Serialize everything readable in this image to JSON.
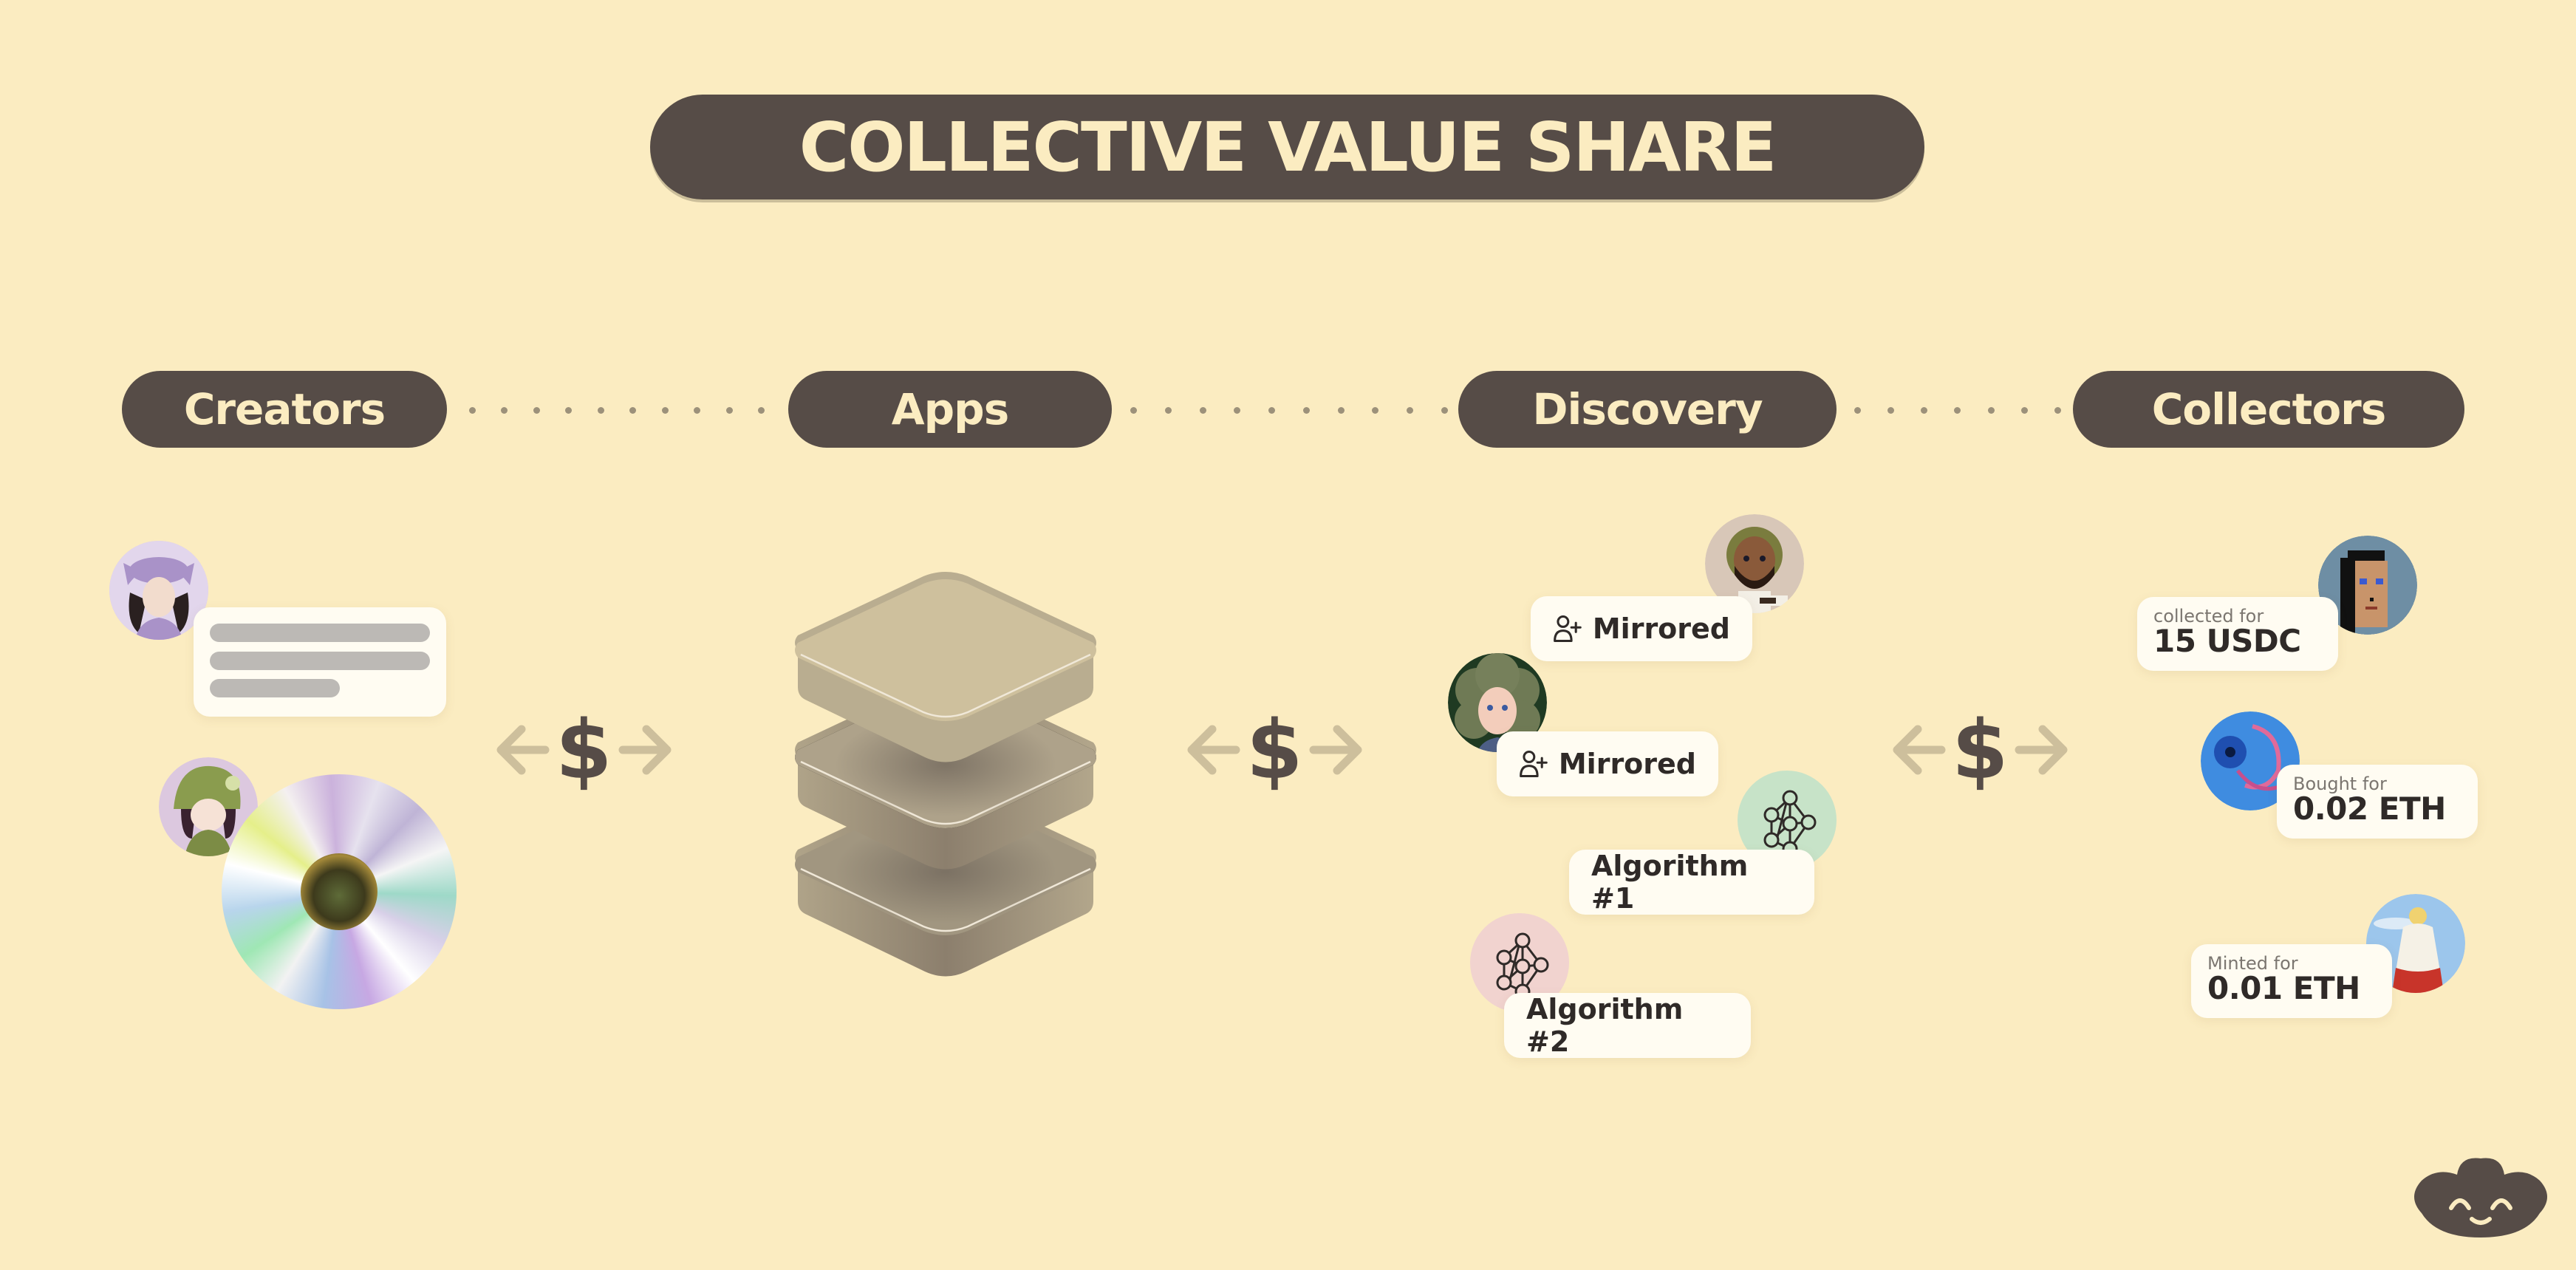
{
  "title": "COLLECTIVE VALUE SHARE",
  "stages": [
    {
      "label": "Creators"
    },
    {
      "label": "Apps"
    },
    {
      "label": "Discovery"
    },
    {
      "label": "Collectors"
    }
  ],
  "flow_symbol": "$",
  "discovery": {
    "mirrors": [
      {
        "label": "Mirrored"
      },
      {
        "label": "Mirrored"
      }
    ],
    "algorithms": [
      {
        "label": "Algorithm #1"
      },
      {
        "label": "Algorithm #2"
      }
    ]
  },
  "collectors": [
    {
      "caption": "collected for",
      "amount": "15 USDC"
    },
    {
      "caption": "Bought for",
      "amount": "0.02 ETH"
    },
    {
      "caption": "Minted for",
      "amount": "0.01 ETH"
    }
  ],
  "colors": {
    "background": "#fbecc1",
    "pill": "#564c47",
    "pill_text": "#fbecc1",
    "card": "#fffcf2",
    "arrow": "#cdbf9c",
    "algo1_bg": "#c7e3c8",
    "algo2_bg": "#f1d3cf"
  }
}
